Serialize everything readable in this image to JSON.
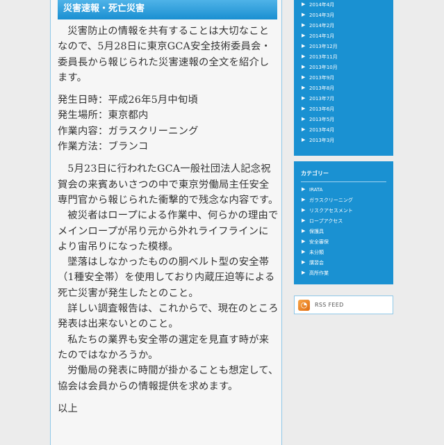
{
  "article": {
    "heading": "災害速報・死亡災害",
    "intro": "災害防止の情報を共有することは大切なことなので、5月28日に東京GCA安全技術委員会・委員長から報じられた災害速報の全文を紹介します。",
    "details": [
      "発生日時：平成26年5月中旬頃",
      "発生場所：東京都内",
      "作業内容：ガラスクリーニング",
      "作業方法：ブランコ"
    ],
    "paragraphs": [
      "5月23日に行われたGCA一般社団法人記念祝賀会の来賓あいさつの中で東京労働局主任安全専門官から報じられた衝撃的で残念な内容です。",
      "被災者はロープによる作業中、何らかの理由でメインロープが吊り元から外れライフラインにより宙吊りになった模様。",
      "墜落はしなかったものの胴ベルト型の安全帯（1種安全帯）を使用しており内蔵圧迫等による死亡災害が発生したとのこと。",
      "詳しい調査報告は、これからで、現在のところ発表は出来ないとのこと。",
      "私たちの業界も安全帯の選定を見直す時が来たのではなかろうか。",
      "労働局の発表に時間が掛かることも想定して、協会は会員からの情報提供を求めます。"
    ],
    "closing": "以上"
  },
  "sidebar": {
    "archives": [
      "2014年4月",
      "2014年3月",
      "2014年2月",
      "2014年1月",
      "2013年12月",
      "2013年11月",
      "2013年10月",
      "2013年9月",
      "2013年8月",
      "2013年7月",
      "2013年6月",
      "2013年5月",
      "2013年4月",
      "2013年3月"
    ],
    "category_title": "カテゴリー",
    "categories": [
      "IRATA",
      "ガラスクリーニング",
      "リスクアセスメント",
      "ロープアクセス",
      "保護具",
      "安全審保",
      "未分類",
      "講習会",
      "高所作業"
    ],
    "rss_label": "RSS FEED",
    "arrow_glyph": "▶",
    "rss_glyph": "◔"
  },
  "colors": {
    "accent": "#1a91d2",
    "heading_gradient_top": "#4fb3e8",
    "page_background": "#ececec",
    "text": "#333333"
  }
}
